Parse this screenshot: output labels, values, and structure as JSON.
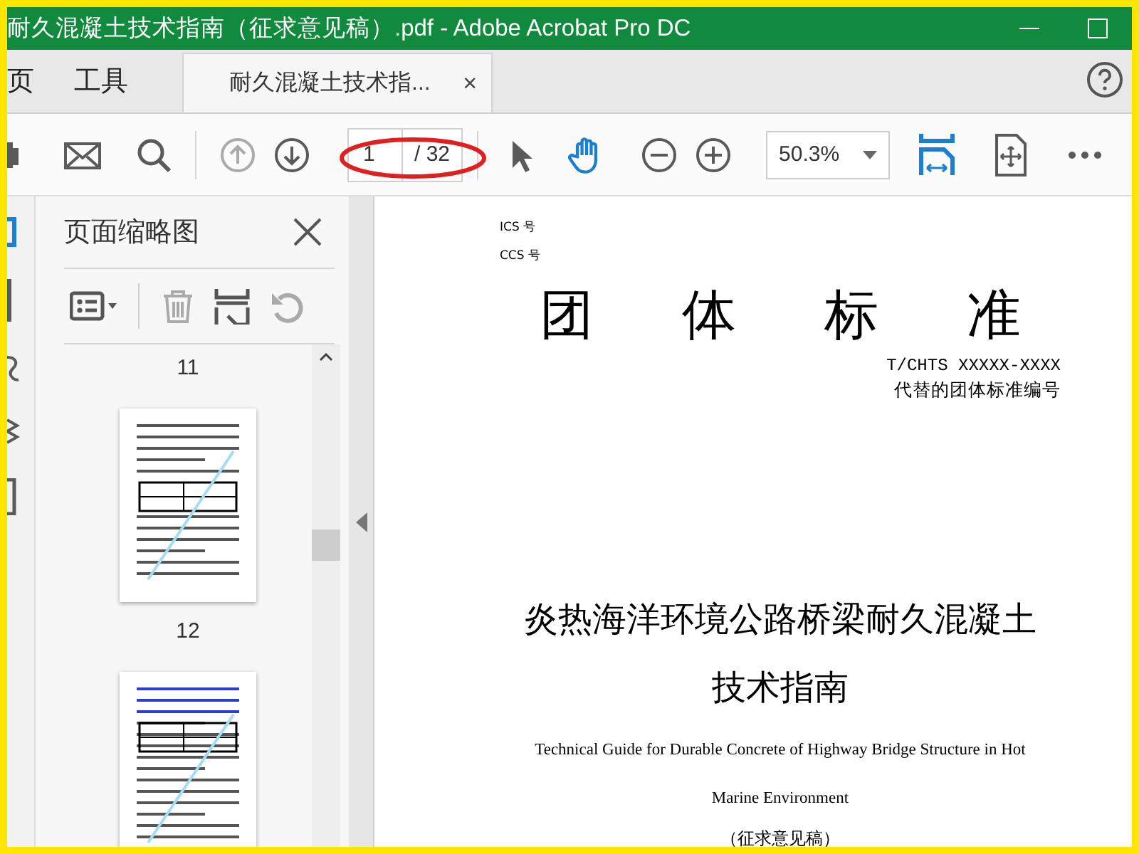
{
  "window": {
    "title": "耐久混凝土技术指南（征求意见稿）.pdf - Adobe Acrobat Pro DC"
  },
  "nav_tabs": [
    {
      "label": "页",
      "selected": false
    },
    {
      "label": "工具",
      "selected": false
    }
  ],
  "document_tab": {
    "label": "耐久混凝土技术指...",
    "selected": true,
    "close": "×"
  },
  "toolbar": {
    "page_input": "1",
    "page_total": "/ 32",
    "zoom": "50.3%"
  },
  "thumbnail_panel": {
    "title": "页面缩略图",
    "page_labels": [
      "11",
      "12"
    ]
  },
  "document": {
    "ics": "ICS 号",
    "ccs": "CCS 号",
    "heading_chars": [
      "团",
      "体",
      "标",
      "准"
    ],
    "code": "T/CHTS XXXXX-XXXX",
    "replaces": "代替的团体标准编号",
    "title_cn": [
      "炎热海洋环境公路桥梁耐久混凝土",
      "技术指南"
    ],
    "title_en": [
      "Technical Guide for Durable Concrete of Highway Bridge Structure in Hot",
      "Marine Environment"
    ],
    "draft": "（征求意见稿）"
  }
}
